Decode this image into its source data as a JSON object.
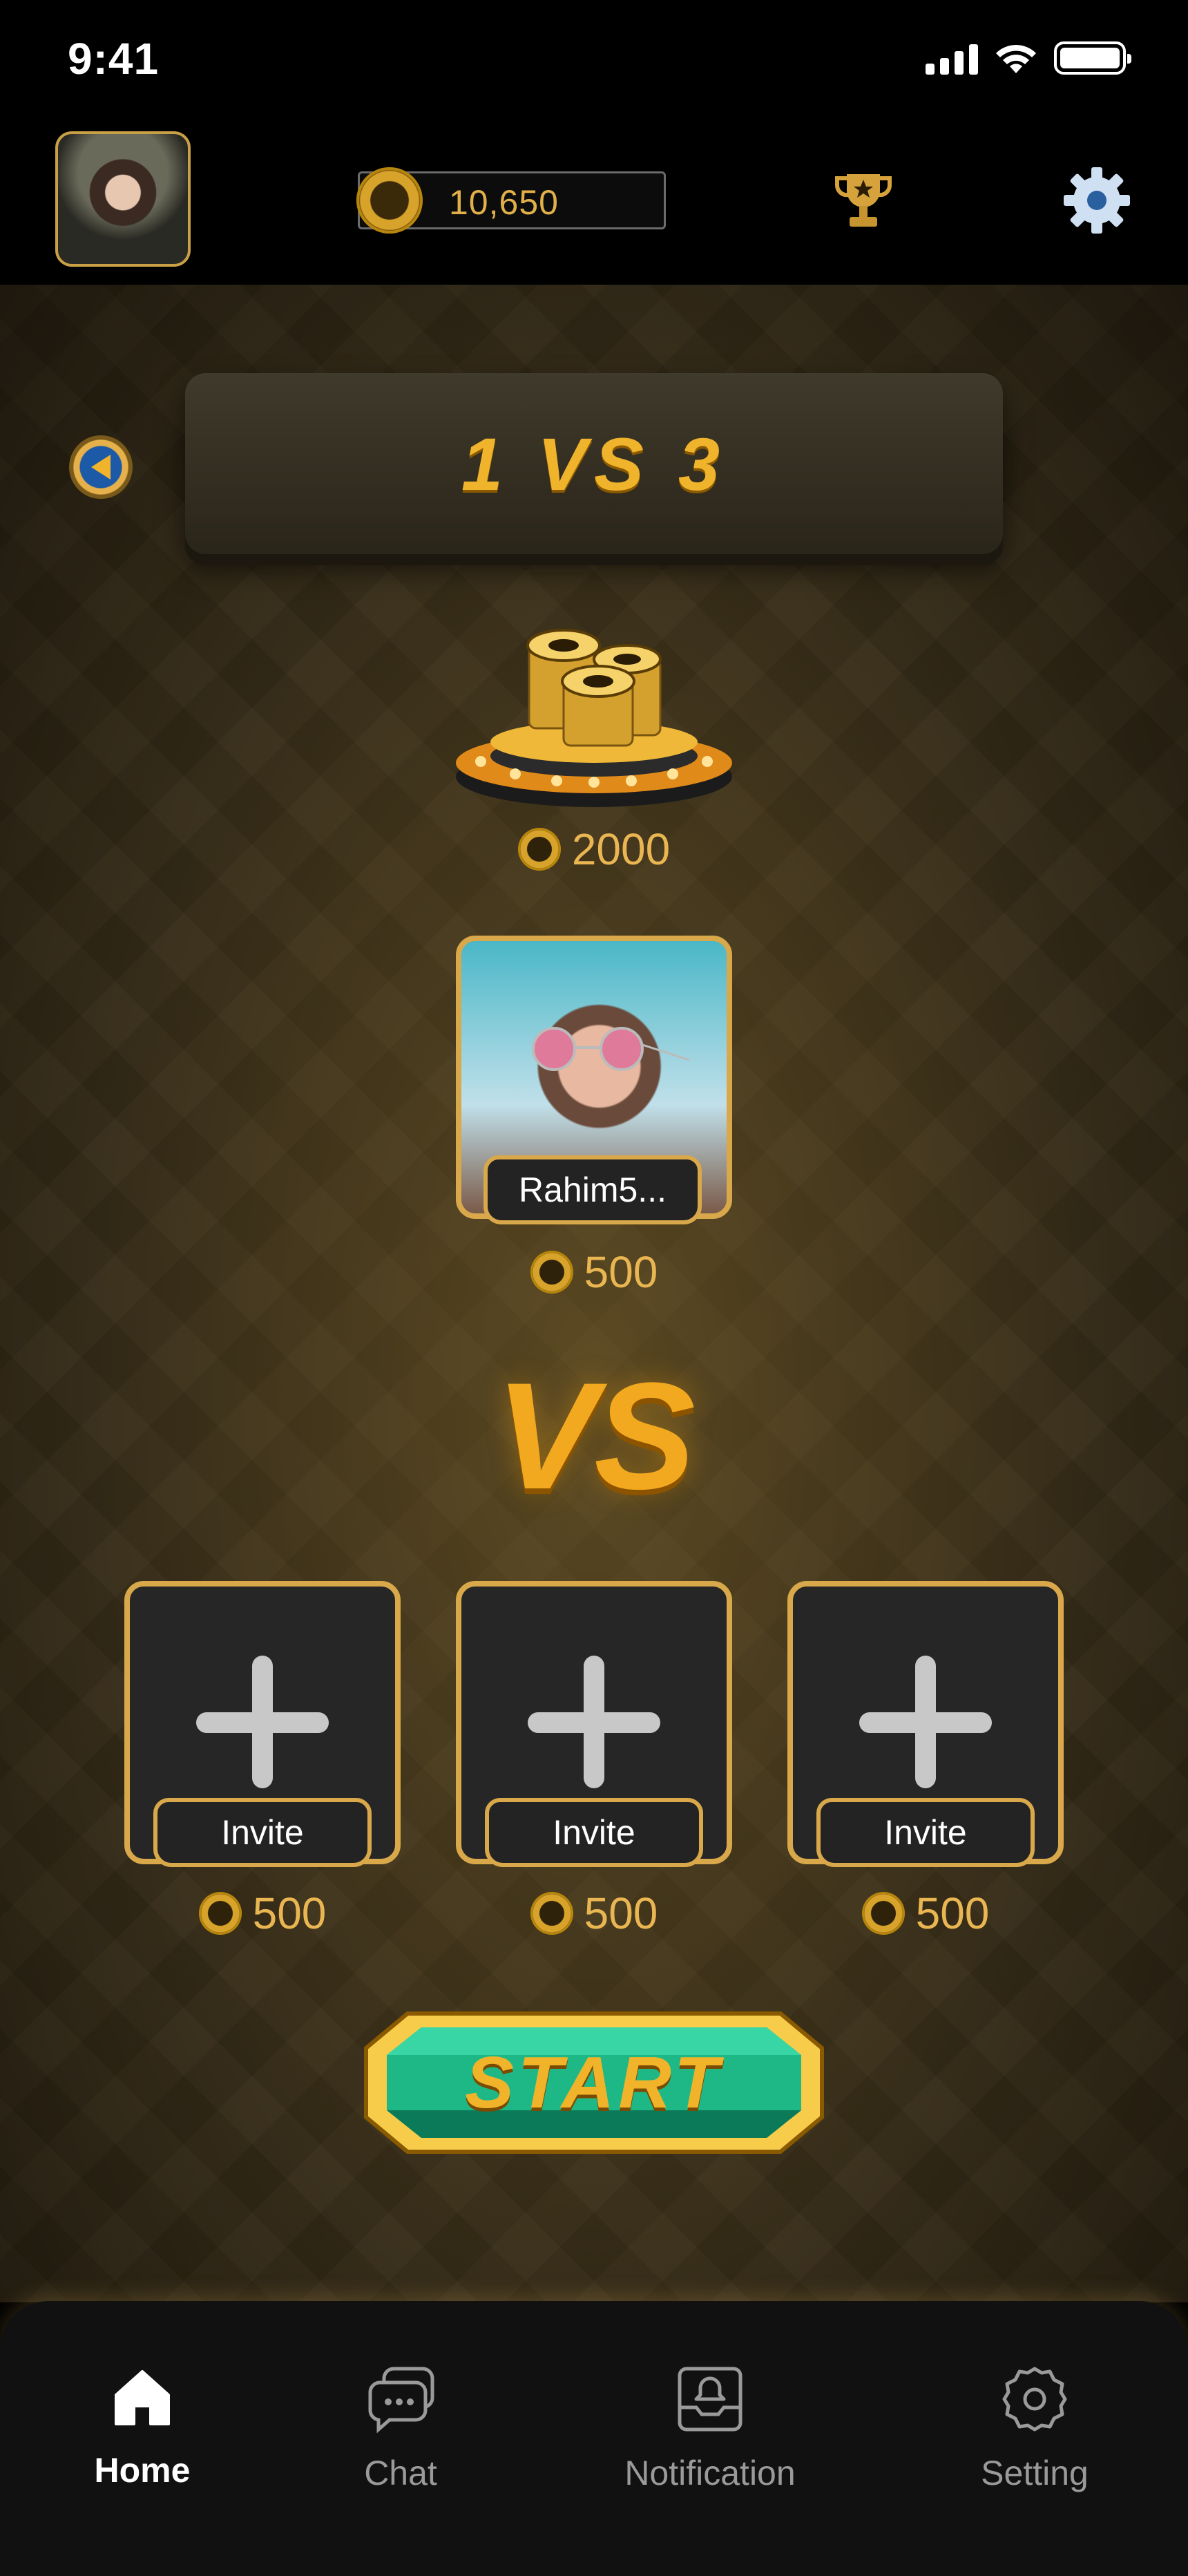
{
  "status_bar": {
    "time": "9:41"
  },
  "header": {
    "coins": "10,650",
    "icons": [
      "trophy-icon",
      "gear-icon"
    ]
  },
  "game": {
    "title": "1 VS 3",
    "prize_amount": "2000",
    "player": {
      "name": "Rahim5...",
      "stake": "500"
    },
    "vs_label": "VS",
    "slots": [
      {
        "label": "Invite",
        "stake": "500"
      },
      {
        "label": "Invite",
        "stake": "500"
      },
      {
        "label": "Invite",
        "stake": "500"
      }
    ],
    "start_label": "START"
  },
  "nav": {
    "items": [
      {
        "label": "Home",
        "icon": "home-icon",
        "active": true
      },
      {
        "label": "Chat",
        "icon": "chat-icon",
        "active": false
      },
      {
        "label": "Notification",
        "icon": "notification-icon",
        "active": false
      },
      {
        "label": "Setting",
        "icon": "setting-icon",
        "active": false
      }
    ]
  },
  "colors": {
    "gold": "#d8a84a",
    "background": "#000000",
    "accent_green": "#1aa97a"
  }
}
